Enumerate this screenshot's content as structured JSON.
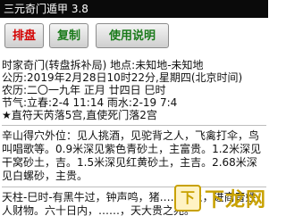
{
  "app": {
    "title": "三元奇门遁甲 3.8"
  },
  "toolbar": {
    "btn1": "排盘",
    "btn2": "复制",
    "btn3": "使用说明"
  },
  "info": {
    "line1": "时家奇门(转盘拆补局) 地点:未知地-未知地",
    "line2": "公历:2019年2月28日10时22分,星期四(北京时间)",
    "line3": "农历:二〇一九年 正月 廿四日 巳时",
    "line4": "节气:立春:2-4 11:14 雨水:2-19 7:4",
    "line5": "★直符天芮落5宫,直使死门落2宫"
  },
  "section1": {
    "text": "辛山得穴外位：见人挑酒，见驼背之人，飞禽打伞，鸟叫唱歌等。0.9米深见紫色青砂土，主富贵。1.2米深见干窝砂土，吉。1.5米深见红黄砂土，主吉。2.68米深见白螺砂，主贵。"
  },
  "section2": {
    "text": "天柱-巳时-有黑牛过，钟声鸣，猪……向上，进商音姓人财物。六十日内，……，天大贵之兆。"
  },
  "watermark": {
    "logo": "下",
    "text": "下龙网"
  },
  "colors": {
    "red": "#d40000",
    "green": "#1a7a1a",
    "watermark": "#c8a100"
  }
}
